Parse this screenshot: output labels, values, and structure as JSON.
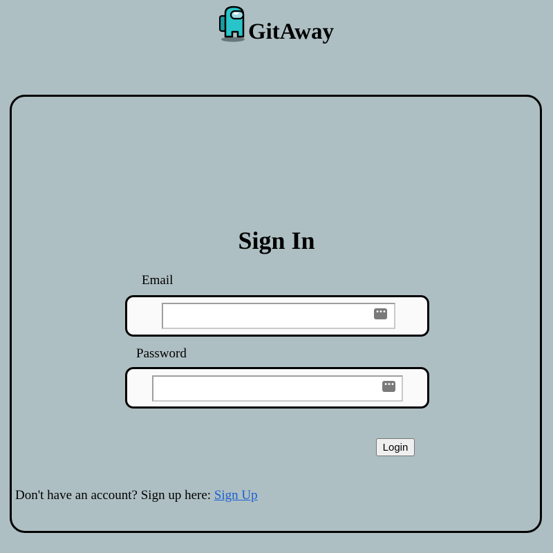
{
  "brand": {
    "name": "GitAway",
    "logo_icon": "crewmate-icon",
    "logo_color": "#29c4c9"
  },
  "signin": {
    "title": "Sign In",
    "email_label": "Email",
    "email_value": "",
    "password_label": "Password",
    "password_value": "",
    "login_button": "Login"
  },
  "footer": {
    "prompt": "Don't have an account? Sign up here: ",
    "link_text": "Sign Up",
    "link_color": "#1a5fd1"
  },
  "colors": {
    "background": "#aebfc3",
    "field_background": "#fafafa",
    "border": "#000000"
  }
}
